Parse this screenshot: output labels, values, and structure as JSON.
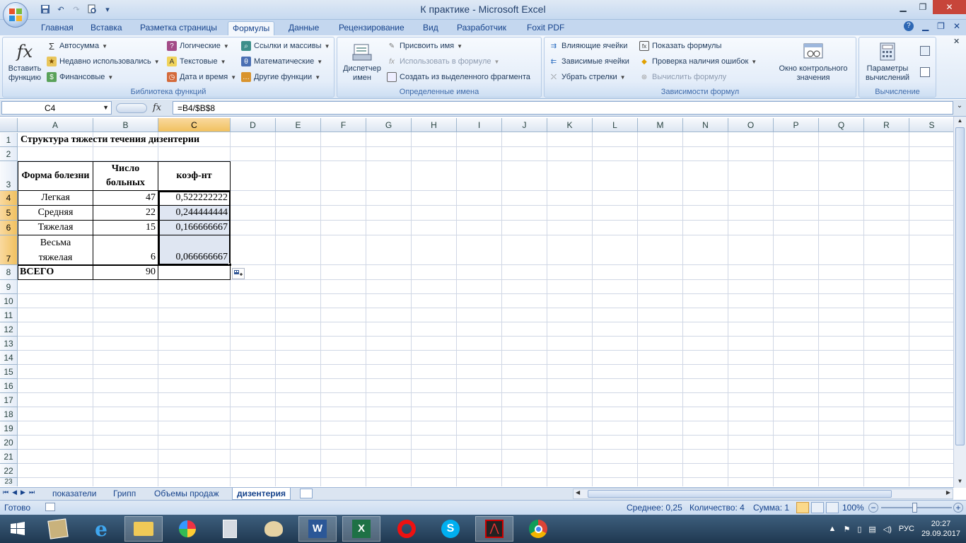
{
  "window": {
    "title": "К практике - Microsoft Excel"
  },
  "ribbon_tabs": [
    "Главная",
    "Вставка",
    "Разметка страницы",
    "Формулы",
    "Данные",
    "Рецензирование",
    "Вид",
    "Разработчик",
    "Foxit PDF"
  ],
  "function_library": {
    "insert_function": "Вставить функцию",
    "autosum": "Автосумма",
    "recent": "Недавно использовались",
    "financial": "Финансовые",
    "logical": "Логические",
    "text": "Текстовые",
    "datetime": "Дата и время",
    "refs": "Ссылки и массивы",
    "math": "Математические",
    "other": "Другие функции",
    "label": "Библиотека функций"
  },
  "defined_names": {
    "manager": "Диспетчер имен",
    "assign_name": "Присвоить имя",
    "use_in_formula": "Использовать в формуле",
    "create_from_selection": "Создать из выделенного фрагмента",
    "label": "Определенные имена"
  },
  "formula_auditing": {
    "trace_precedents": "Влияющие ячейки",
    "trace_dependents": "Зависимые ячейки",
    "remove_arrows": "Убрать стрелки",
    "show_formulas": "Показать формулы",
    "error_checking": "Проверка наличия ошибок",
    "evaluate": "Вычислить формулу",
    "watch_window": "Окно контрольного значения",
    "label": "Зависимости формул"
  },
  "calculation": {
    "options": "Параметры вычислений",
    "label": "Вычисление"
  },
  "formula_bar": {
    "name_box": "C4",
    "fx": "fx",
    "formula": "=B4/$B$8"
  },
  "columns": [
    "A",
    "B",
    "C",
    "D",
    "E",
    "F",
    "G",
    "H",
    "I",
    "J",
    "K",
    "L",
    "M",
    "N",
    "O",
    "P",
    "Q",
    "R",
    "S"
  ],
  "rows": [
    "1",
    "2",
    "3",
    "4",
    "5",
    "6",
    "7",
    "8",
    "9",
    "10",
    "11",
    "12",
    "13",
    "14",
    "15",
    "16",
    "17",
    "18",
    "19",
    "20",
    "21",
    "22",
    "23"
  ],
  "sheet": {
    "title": "Структура тяжести течения дизентерии",
    "headers": {
      "a": "Форма болезни",
      "b": "Число больных",
      "c": "коэф-нт"
    },
    "data": [
      {
        "a": "Легкая",
        "b": "47",
        "c": "0,522222222"
      },
      {
        "a": "Средняя",
        "b": "22",
        "c": "0,244444444"
      },
      {
        "a": "Тяжелая",
        "b": "15",
        "c": "0,166666667"
      },
      {
        "a": "Весьма тяжелая",
        "b": "6",
        "c": "0,066666667"
      }
    ],
    "total": {
      "a": "ВСЕГО",
      "b": "90"
    }
  },
  "sheet_tabs": [
    "показатели",
    "Грипп",
    "Объемы продаж",
    "дизентерия"
  ],
  "status": {
    "ready": "Готово",
    "average": "Среднее: 0,25",
    "count": "Количество: 4",
    "sum": "Сумма: 1",
    "zoom": "100%"
  },
  "taskbar": {
    "lang": "РУС",
    "time": "20:27",
    "date": "29.09.2017"
  }
}
